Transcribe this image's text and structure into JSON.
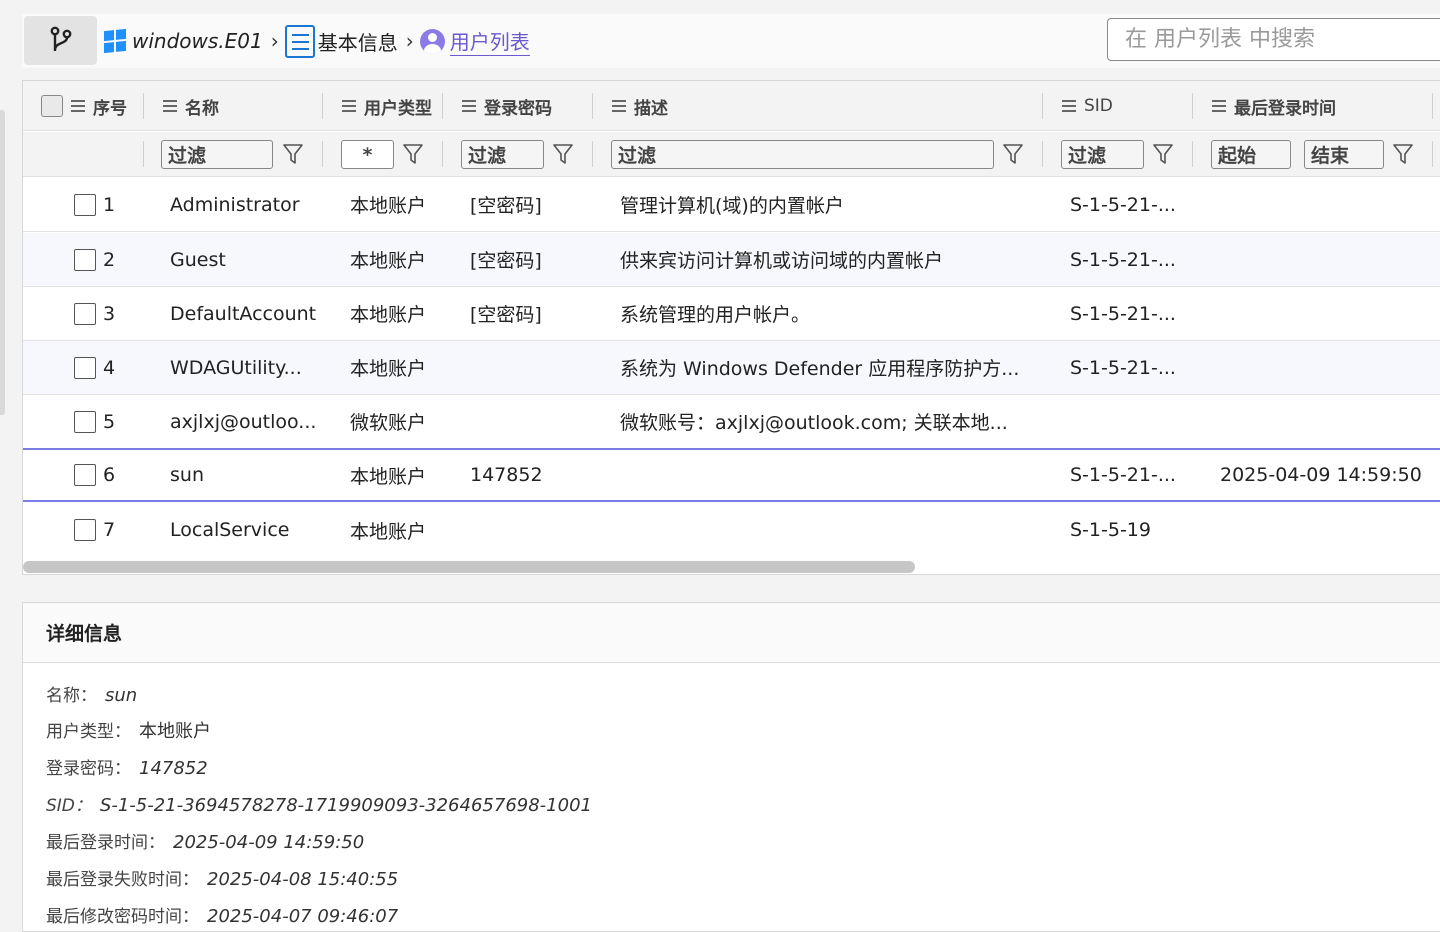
{
  "breadcrumb": {
    "items": [
      {
        "label": "windows.E01",
        "icon": "windows-icon"
      },
      {
        "label": "基本信息",
        "icon": "list-icon"
      },
      {
        "label": "用户列表",
        "icon": "user-icon"
      }
    ],
    "separator": "›"
  },
  "search": {
    "placeholder": "在 用户列表 中搜索"
  },
  "table": {
    "columns": [
      "序号",
      "名称",
      "用户类型",
      "登录密码",
      "描述",
      "SID",
      "最后登录时间"
    ],
    "filters": {
      "name": "过滤",
      "type": "*",
      "password": "过滤",
      "desc": "过滤",
      "sid": "过滤",
      "time_start": "起始",
      "time_end": "结束"
    },
    "rows": [
      {
        "idx": "1",
        "name": "Administrator",
        "type": "本地账户",
        "password": "[空密码]",
        "desc": "管理计算机(域)的内置帐户",
        "sid": "S-1-5-21-...",
        "last_login": ""
      },
      {
        "idx": "2",
        "name": "Guest",
        "type": "本地账户",
        "password": "[空密码]",
        "desc": "供来宾访问计算机或访问域的内置帐户",
        "sid": "S-1-5-21-...",
        "last_login": ""
      },
      {
        "idx": "3",
        "name": "DefaultAccount",
        "type": "本地账户",
        "password": "[空密码]",
        "desc": "系统管理的用户帐户。",
        "sid": "S-1-5-21-...",
        "last_login": ""
      },
      {
        "idx": "4",
        "name": "WDAGUtility...",
        "type": "本地账户",
        "password": "",
        "desc": "系统为 Windows Defender 应用程序防护方...",
        "sid": "S-1-5-21-...",
        "last_login": ""
      },
      {
        "idx": "5",
        "name": "axjlxj@outloo...",
        "type": "微软账户",
        "password": "",
        "desc": "微软账号：axjlxj@outlook.com; 关联本地...",
        "sid": "",
        "last_login": ""
      },
      {
        "idx": "6",
        "name": "sun",
        "type": "本地账户",
        "password": "147852",
        "desc": "",
        "sid": "S-1-5-21-...",
        "last_login": "2025-04-09 14:59:50"
      },
      {
        "idx": "7",
        "name": "LocalService",
        "type": "本地账户",
        "password": "",
        "desc": "",
        "sid": "S-1-5-19",
        "last_login": ""
      }
    ]
  },
  "detail": {
    "title": "详细信息",
    "fields": [
      {
        "key": "名称：",
        "value": "sun"
      },
      {
        "key": "用户类型：",
        "value": "本地账户"
      },
      {
        "key": "登录密码：",
        "value": "147852"
      },
      {
        "key": "SID：",
        "value": "S-1-5-21-3694578278-1719909093-3264657698-1001"
      },
      {
        "key": "最后登录时间：",
        "value": "2025-04-09 14:59:50"
      },
      {
        "key": "最后登录失败时间：",
        "value": "2025-04-08 15:40:55"
      },
      {
        "key": "最后修改密码时间：",
        "value": "2025-04-07 09:46:07"
      }
    ]
  },
  "colors": {
    "accent": "#6a5acd",
    "selected_border": "#7b7be8",
    "windows_blue": "#1e90ff"
  }
}
